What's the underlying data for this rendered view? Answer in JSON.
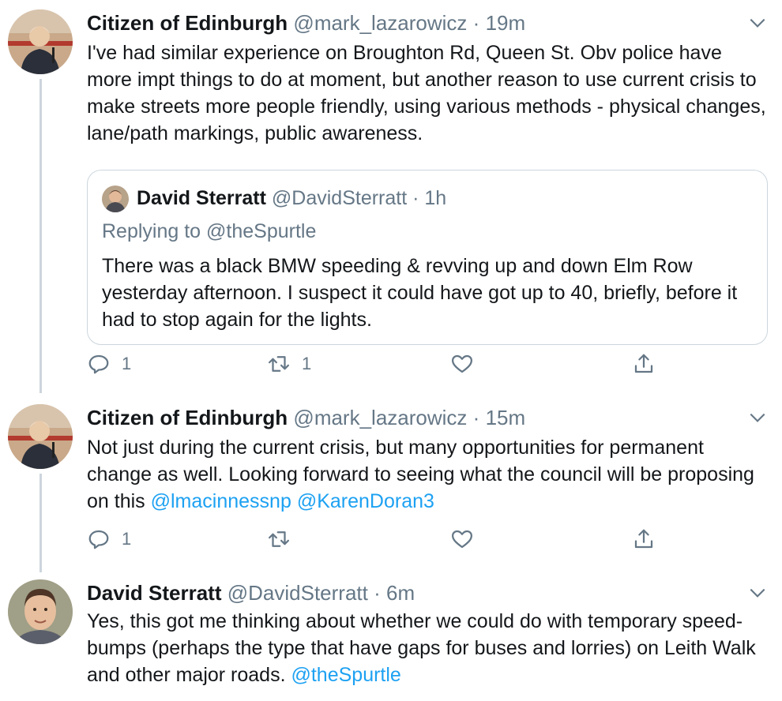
{
  "tweets": [
    {
      "name": "Citizen of Edinburgh",
      "handle": "@mark_lazarowicz",
      "dot": "·",
      "time": "19m",
      "text": "I've had similar experience on Broughton Rd, Queen St. Obv police have more impt things to do at moment, but another reason to use current crisis to make streets more people friendly, using various methods - physical changes, lane/path markings, public awareness.",
      "quote": {
        "name": "David Sterratt",
        "handle": "@DavidSterratt",
        "dot": "·",
        "time": "1h",
        "replying_prefix": "Replying to",
        "replying_to": "@theSpurtle",
        "text": "There was a black BMW speeding & revving up and down Elm Row yesterday afternoon. I suspect it could have got up to 40, briefly, before it had to stop again for the lights."
      },
      "reply_count": "1",
      "retweet_count": "1"
    },
    {
      "name": "Citizen of Edinburgh",
      "handle": "@mark_lazarowicz",
      "dot": "·",
      "time": "15m",
      "text": "Not just during the current crisis, but many opportunities for permanent change as well. Looking forward to seeing what the council will be proposing on this",
      "mention1": "@lmacinnessnp",
      "mention2": "@KarenDoran3",
      "reply_count": "1"
    },
    {
      "name": "David Sterratt",
      "handle": "@DavidSterratt",
      "dot": "·",
      "time": "6m",
      "text": "Yes, this got me thinking about whether we could do with temporary speed-bumps (perhaps  the type that have gaps for buses and lorries) on Leith Walk and other major roads.",
      "mention": "@theSpurtle"
    }
  ],
  "icons": {
    "reply": "reply-icon",
    "retweet": "retweet-icon",
    "like": "like-icon",
    "share": "share-icon",
    "caret": "chevron-down-icon"
  },
  "colors": {
    "link": "#1da1f2",
    "muted": "#657786",
    "line": "#cdd5de"
  }
}
